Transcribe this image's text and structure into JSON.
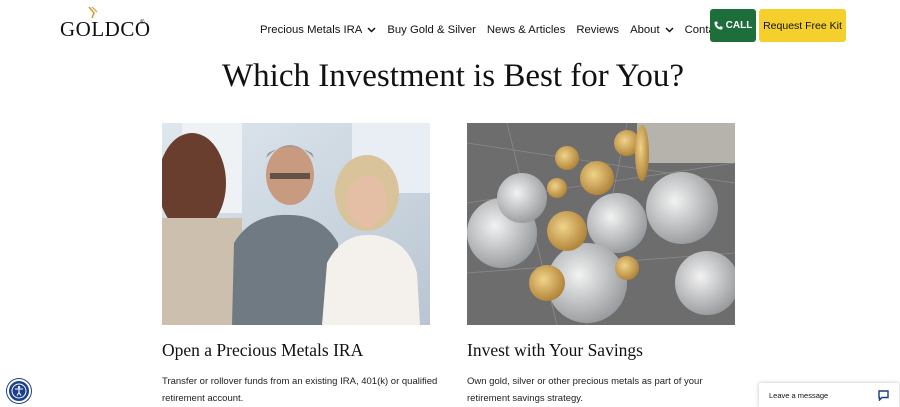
{
  "brand": {
    "logo_text": "GOLDCO",
    "registered": "®",
    "gold": "#c9a233"
  },
  "nav": {
    "items": [
      {
        "label": "Precious Metals IRA",
        "has_dropdown": true
      },
      {
        "label": "Buy Gold & Silver",
        "has_dropdown": false
      },
      {
        "label": "News & Articles",
        "has_dropdown": false
      },
      {
        "label": "Reviews",
        "has_dropdown": false
      },
      {
        "label": "About",
        "has_dropdown": true
      },
      {
        "label": "Contact Us",
        "has_dropdown": false
      }
    ],
    "call_label": "CALL",
    "call_icon": "phone-icon",
    "cta_label": "Request Free Kit"
  },
  "main": {
    "title": "Which Investment is Best for You?",
    "cards": [
      {
        "image": "couple-consultation-photo",
        "title": "Open a Precious Metals IRA",
        "description": "Transfer or rollover funds from an existing IRA, 401(k) or qualified retirement account."
      },
      {
        "image": "gold-silver-coins-photo",
        "title": "Invest with Your Savings",
        "description": "Own gold, silver or other precious metals as part of your retirement savings strategy."
      }
    ]
  },
  "widgets": {
    "accessibility_icon": "accessibility-icon",
    "chat_label": "Leave a message",
    "chat_icon": "chat-bubble-icon"
  },
  "colors": {
    "call_green": "#1e6e3c",
    "cta_yellow": "#f5cf2b",
    "a11y_blue": "#1c3f8c"
  }
}
